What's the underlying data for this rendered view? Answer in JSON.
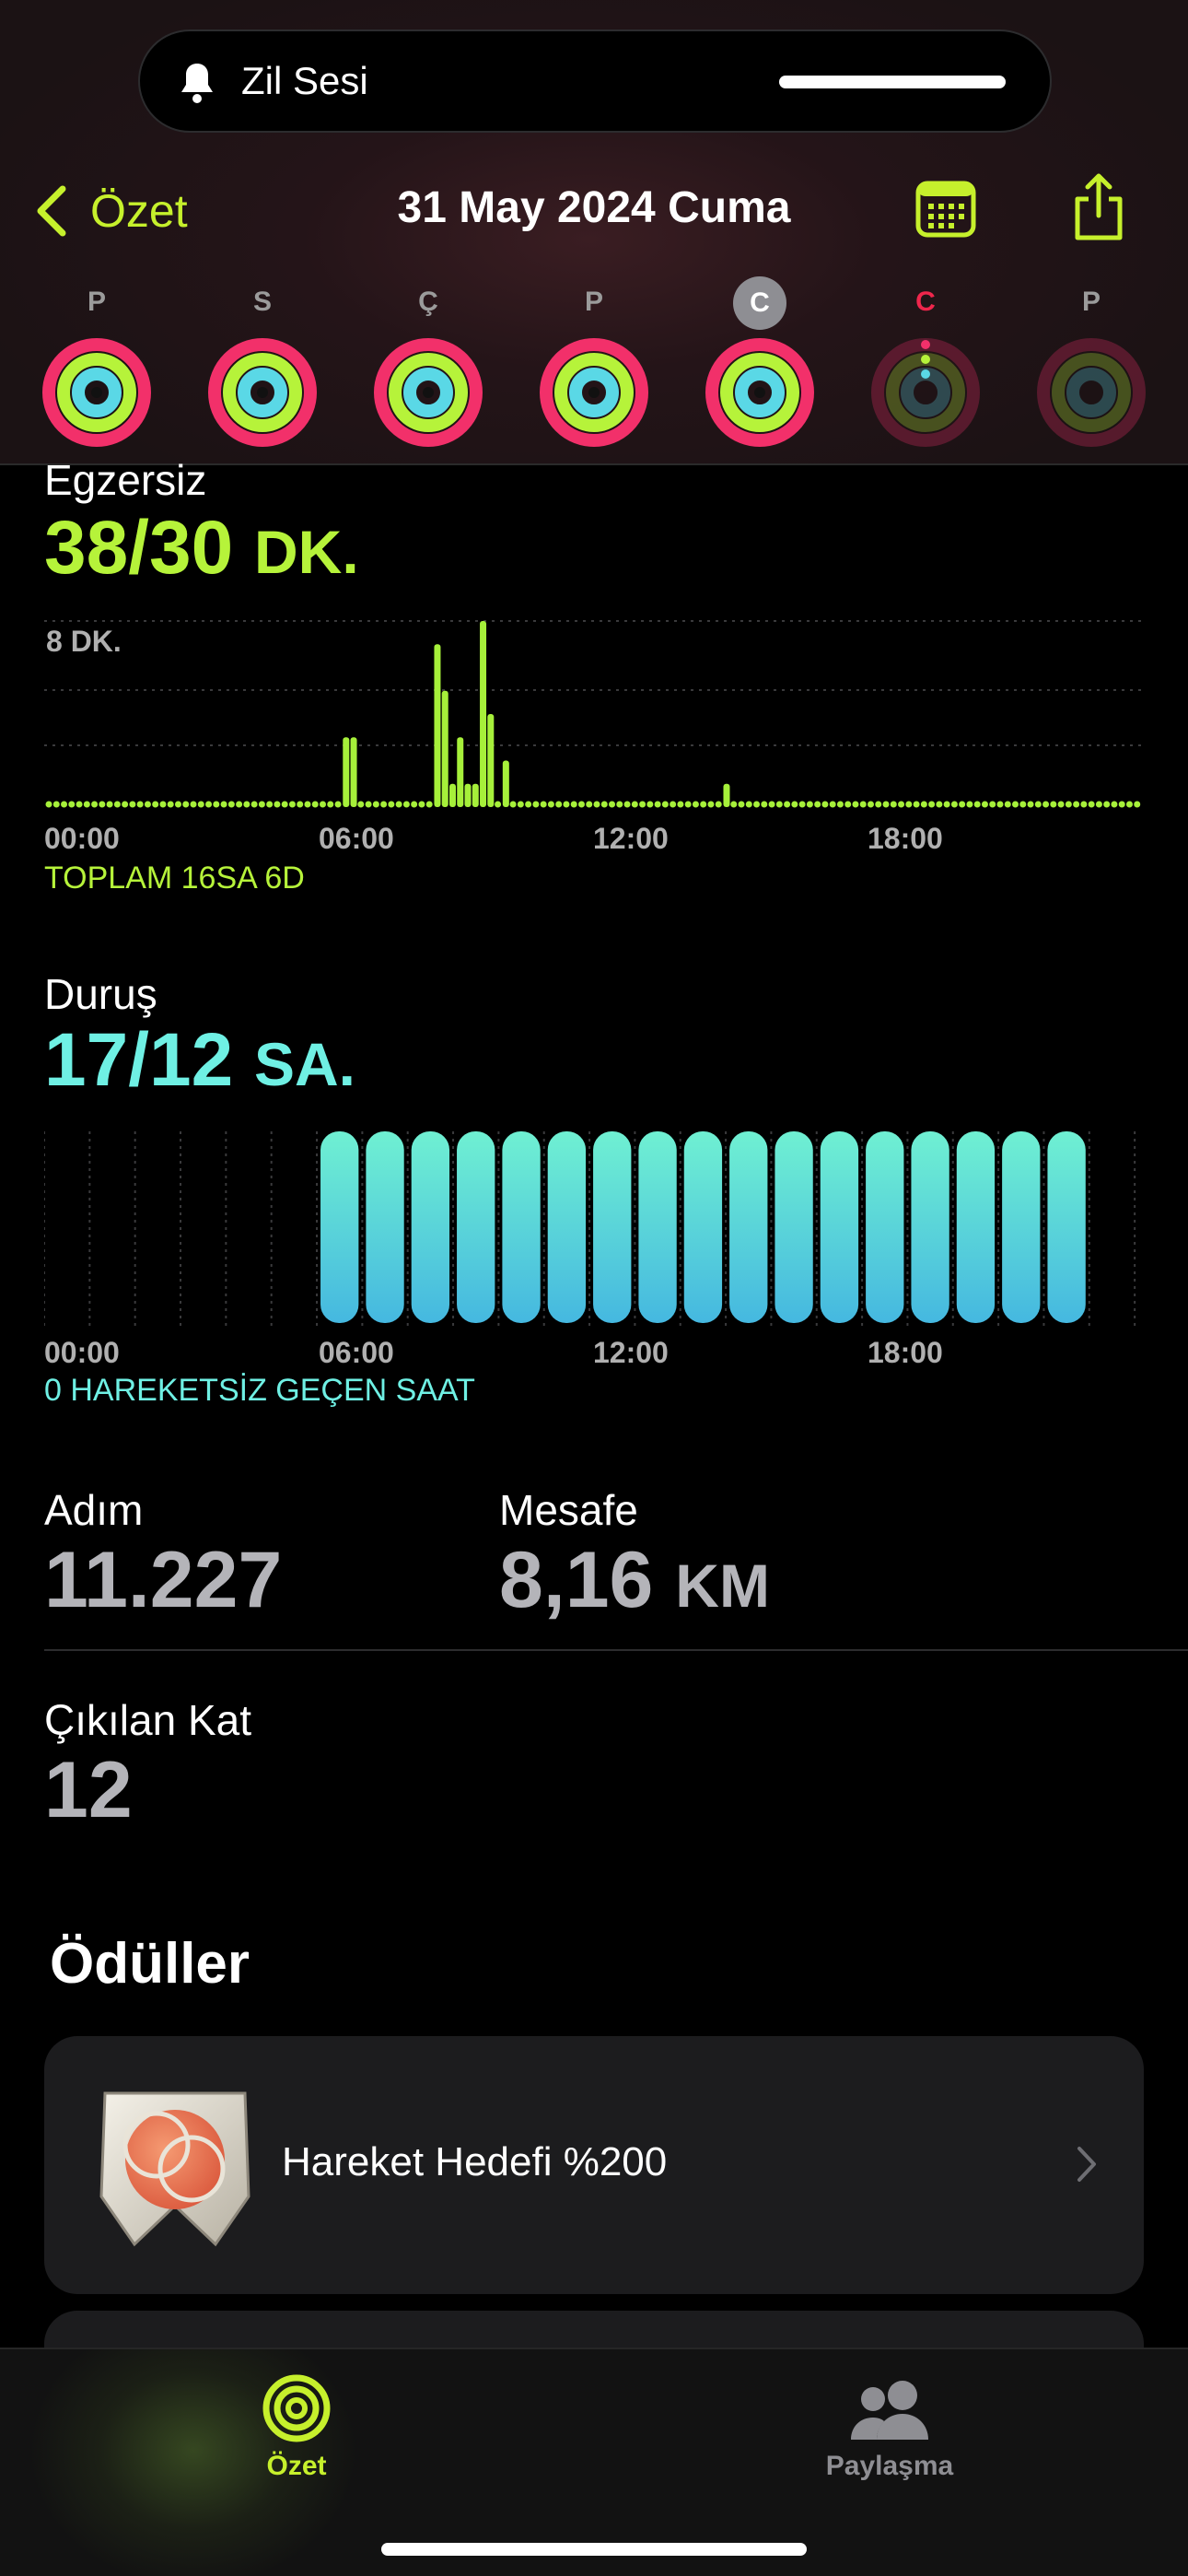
{
  "notification": {
    "text": "Zil Sesi",
    "icon": "bell-icon"
  },
  "nav": {
    "back_label": "Özet",
    "title": "31 May 2024 Cuma",
    "calendar_icon": "calendar-icon",
    "share_icon": "share-icon"
  },
  "week": [
    {
      "label": "P",
      "state": "complete"
    },
    {
      "label": "S",
      "state": "complete"
    },
    {
      "label": "Ç",
      "state": "complete"
    },
    {
      "label": "P",
      "state": "complete"
    },
    {
      "label": "C",
      "state": "selected"
    },
    {
      "label": "C",
      "state": "today"
    },
    {
      "label": "P",
      "state": "empty"
    }
  ],
  "exercise": {
    "title": "Egzersiz",
    "value": "38/30",
    "unit": "DK.",
    "y_label": "8 DK.",
    "x_labels": [
      "00:00",
      "06:00",
      "12:00",
      "18:00"
    ],
    "total": "TOPLAM 16SA 6D",
    "color": "#a6f03a"
  },
  "stand": {
    "title": "Duruş",
    "value": "17/12",
    "unit": "SA.",
    "x_labels": [
      "00:00",
      "06:00",
      "12:00",
      "18:00"
    ],
    "footer": "0 HAREKETSİZ GEÇEN SAAT",
    "color": "#6ff0e4"
  },
  "stats": {
    "steps_label": "Adım",
    "steps_value": "11.227",
    "distance_label": "Mesafe",
    "distance_value": "8,16",
    "distance_unit": "KM",
    "floors_label": "Çıkılan Kat",
    "floors_value": "12"
  },
  "awards": {
    "title": "Ödüller",
    "items": [
      {
        "name": "Hareket Hedefi %200"
      }
    ]
  },
  "tabbar": {
    "tabs": [
      {
        "label": "Özet",
        "icon": "activity-rings-icon",
        "active": true
      },
      {
        "label": "Paylaşma",
        "icon": "people-icon",
        "active": false
      }
    ]
  },
  "colors": {
    "move": "#f2306a",
    "exercise": "#b6f33a",
    "stand": "#5ad8e6",
    "accent": "#c6f02c"
  },
  "chart_data": [
    {
      "type": "bar",
      "title": "Egzersiz",
      "ylabel": "8 DK.",
      "x_tick_labels": [
        "00:00",
        "06:00",
        "12:00",
        "18:00"
      ],
      "xlim_hours": [
        0,
        24
      ],
      "ylim": [
        0,
        8
      ],
      "bins_per_hour": 12,
      "values_minutes": [
        0,
        0,
        0,
        0,
        0,
        0,
        0,
        0,
        0,
        0,
        0,
        0,
        0,
        0,
        0,
        0,
        0,
        0,
        0,
        0,
        0,
        0,
        0,
        0,
        0,
        0,
        0,
        0,
        0,
        0,
        0,
        0,
        0,
        0,
        0,
        0,
        0,
        0,
        0,
        0,
        0,
        0,
        0,
        0,
        0,
        0,
        0,
        0,
        0,
        0,
        0,
        0,
        0,
        0,
        0,
        0,
        0,
        0,
        0,
        0,
        0,
        0,
        0,
        0,
        0,
        0,
        0,
        0,
        0,
        0,
        0,
        0,
        0,
        0,
        0,
        0,
        0,
        0,
        0,
        0,
        0,
        0,
        0,
        0,
        0,
        0,
        0,
        0,
        0,
        0,
        0,
        0,
        0,
        0,
        0,
        0,
        0,
        0,
        0,
        0,
        0,
        0,
        0,
        0,
        0,
        0,
        0,
        0,
        0,
        0,
        0,
        0,
        0,
        0,
        0,
        0,
        0,
        0,
        0,
        0,
        0,
        0,
        0,
        0,
        0,
        0,
        0,
        0,
        0,
        0,
        0,
        0,
        0,
        0,
        0,
        0,
        0,
        0,
        0,
        0,
        0,
        0,
        0,
        0,
        0,
        0,
        0,
        0,
        0,
        0,
        0,
        0,
        0,
        0,
        0,
        0,
        0,
        0,
        0,
        0,
        0,
        0,
        0,
        0,
        0,
        0,
        0,
        0,
        0,
        0,
        0,
        0,
        0,
        0,
        0,
        0,
        0,
        0,
        0,
        0,
        0,
        0,
        0,
        0,
        0,
        0,
        0,
        0,
        0,
        0,
        0,
        0,
        0,
        0,
        0,
        0,
        0,
        0,
        0,
        0,
        0,
        0,
        0,
        0,
        0,
        0,
        0,
        0,
        0,
        0,
        0,
        0,
        0,
        0,
        0,
        0,
        0,
        0,
        0,
        0,
        0,
        0,
        0,
        0,
        0,
        0,
        0,
        0,
        0,
        0,
        0,
        0,
        0,
        0,
        0,
        0,
        0,
        0,
        0,
        0,
        0,
        0,
        0,
        0,
        0,
        0,
        0,
        0,
        0,
        0,
        0,
        0,
        0,
        0,
        0,
        0,
        0,
        0,
        0,
        0,
        0,
        0,
        0,
        0,
        0,
        0,
        0,
        0,
        0,
        0,
        0,
        0,
        0,
        0,
        0,
        0,
        0,
        0,
        0,
        0,
        0,
        0,
        0,
        0,
        0,
        0,
        0,
        0
      ],
      "active_bins": {
        "78": 3,
        "80": 3,
        "102": 7,
        "104": 5,
        "106": 1,
        "108": 3,
        "110": 1,
        "112": 1,
        "114": 8,
        "116": 4,
        "120": 2,
        "178": 1
      }
    },
    {
      "type": "bar",
      "title": "Duruş",
      "x_tick_labels": [
        "00:00",
        "06:00",
        "12:00",
        "18:00"
      ],
      "hours": [
        0,
        1,
        2,
        3,
        4,
        5,
        6,
        7,
        8,
        9,
        10,
        11,
        12,
        13,
        14,
        15,
        16,
        17,
        18,
        19,
        20,
        21,
        22,
        23
      ],
      "stood": [
        0,
        0,
        0,
        0,
        0,
        0,
        1,
        1,
        1,
        1,
        1,
        1,
        1,
        1,
        1,
        1,
        1,
        1,
        1,
        1,
        1,
        1,
        1,
        0
      ]
    }
  ]
}
